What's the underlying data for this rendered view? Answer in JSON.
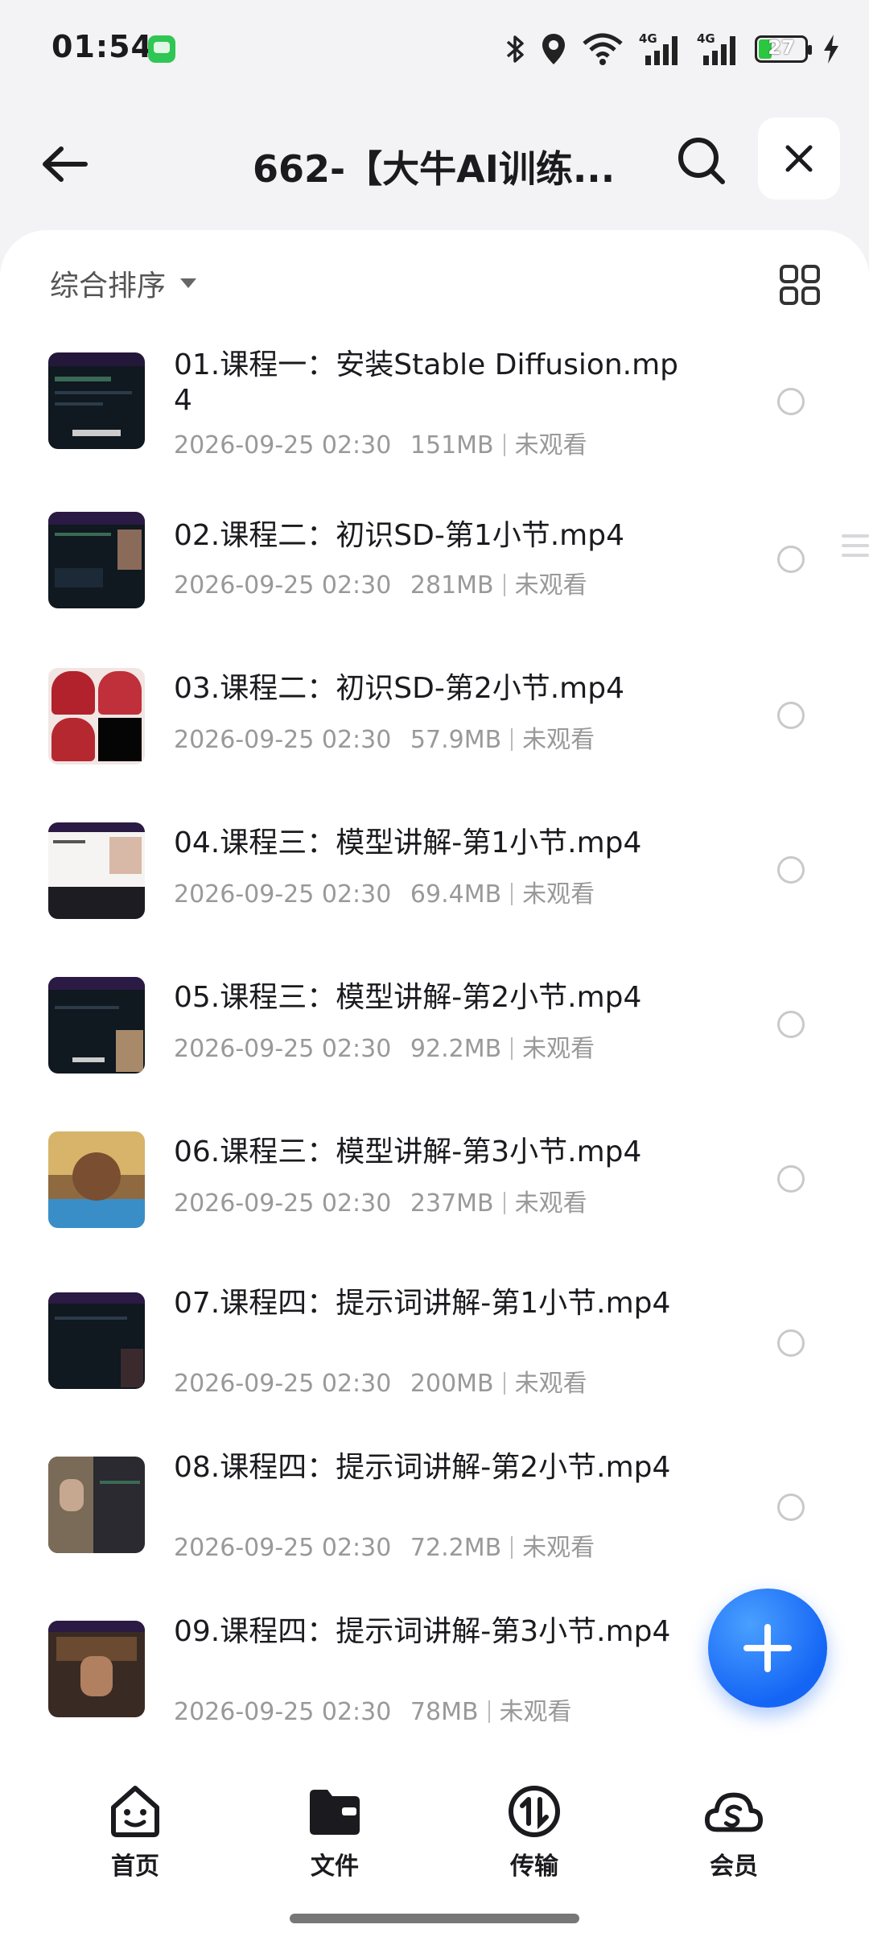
{
  "status_bar": {
    "time": "01:54",
    "battery": "27",
    "battery_level": 0.27,
    "icons": [
      "bluetooth-icon",
      "location-icon",
      "wifi-icon",
      "signal-4g-icon",
      "signal-4g-icon",
      "battery-icon",
      "charging-icon"
    ]
  },
  "header": {
    "title": "662-【大牛AI训练...",
    "back_icon": "arrow-left-icon",
    "search_icon": "search-icon",
    "close_icon": "close-icon"
  },
  "toolbar": {
    "sort_label": "综合排序",
    "view_toggle_icon": "grid-view-icon"
  },
  "files": [
    {
      "name": "01.课程一：安装Stable Diffusion.mp4",
      "date": "2026-09-25 02:30",
      "size": "151MB",
      "status": "未观看"
    },
    {
      "name": "02.课程二：初识SD-第1小节.mp4",
      "date": "2026-09-25 02:30",
      "size": "281MB",
      "status": "未观看"
    },
    {
      "name": "03.课程二：初识SD-第2小节.mp4",
      "date": "2026-09-25 02:30",
      "size": "57.9MB",
      "status": "未观看"
    },
    {
      "name": "04.课程三：模型讲解-第1小节.mp4",
      "date": "2026-09-25 02:30",
      "size": "69.4MB",
      "status": "未观看"
    },
    {
      "name": "05.课程三：模型讲解-第2小节.mp4",
      "date": "2026-09-25 02:30",
      "size": "92.2MB",
      "status": "未观看"
    },
    {
      "name": "06.课程三：模型讲解-第3小节.mp4",
      "date": "2026-09-25 02:30",
      "size": "237MB",
      "status": "未观看"
    },
    {
      "name": "07.课程四：提示词讲解-第1小节.mp4",
      "date": "2026-09-25 02:30",
      "size": "200MB",
      "status": "未观看"
    },
    {
      "name": "08.课程四：提示词讲解-第2小节.mp4",
      "date": "2026-09-25 02:30",
      "size": "72.2MB",
      "status": "未观看"
    },
    {
      "name": "09.课程四：提示词讲解-第3小节.mp4",
      "date": "2026-09-25 02:30",
      "size": "78MB",
      "status": "未观看"
    }
  ],
  "fab": {
    "icon": "plus-icon",
    "color": "#1565f5"
  },
  "bottom_nav": [
    {
      "label": "首页",
      "icon": "home-face-icon"
    },
    {
      "label": "文件",
      "icon": "folder-icon"
    },
    {
      "label": "传输",
      "icon": "transfer-icon"
    },
    {
      "label": "会员",
      "icon": "cloud-vip-icon"
    }
  ]
}
